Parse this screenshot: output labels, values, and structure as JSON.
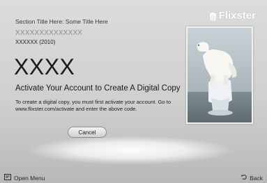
{
  "header": {
    "section_title": "Section Title Here: Some Title Here",
    "brand_name": "Flixster",
    "brand_icon": "popcorn-bucket-icon"
  },
  "movie": {
    "title": "XXXXXXXXXXXXXX",
    "meta": "XXXXXX (2010)"
  },
  "activation": {
    "code": "XXXX",
    "heading": "Activate Your Account to Create A Digital Copy",
    "instructions": "To create a digital copy, you must first activate your account. Go to www.flixster.com/activate and enter the above code.",
    "cancel_label": "Cancel"
  },
  "footer": {
    "open_menu_label": "Open Menu",
    "open_menu_icon": "menu-icon",
    "back_label": "Back",
    "back_icon": "return-arrow-icon"
  },
  "colors": {
    "background": "#d4d4d4",
    "text": "#1a1a1a",
    "muted_text": "#8a8a8a",
    "brand": "#ffffff"
  }
}
